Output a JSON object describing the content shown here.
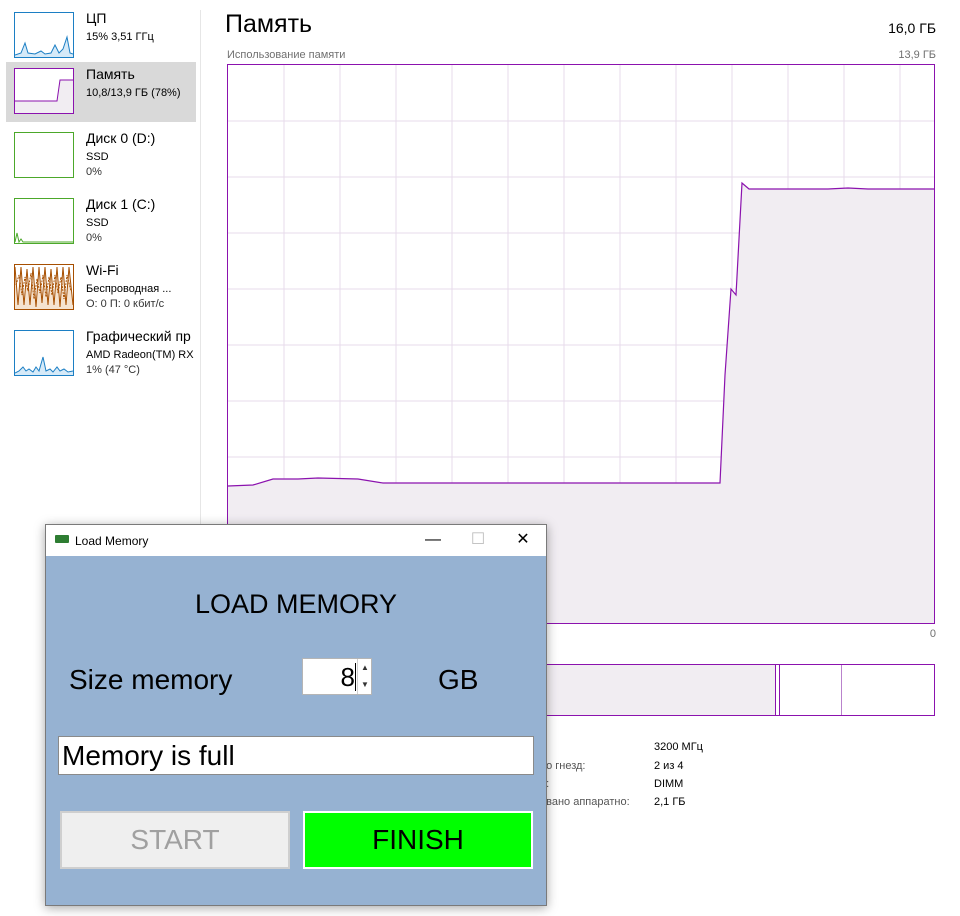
{
  "side": {
    "items": [
      {
        "title": "ЦП",
        "line1": "15%  3,51 ГГц",
        "line2": ""
      },
      {
        "title": "Память",
        "line1": "10,8/13,9 ГБ (78%)",
        "line2": ""
      },
      {
        "title": "Диск 0 (D:)",
        "line1": "SSD",
        "line2": "0%"
      },
      {
        "title": "Диск 1 (C:)",
        "line1": "SSD",
        "line2": "0%"
      },
      {
        "title": "Wi-Fi",
        "line1": "Беспроводная ...",
        "line2": "О: 0  П: 0 кбит/с"
      },
      {
        "title": "Графический пр",
        "line1": "AMD Radeon(TM) RX",
        "line2": "1%  (47 °C)"
      }
    ]
  },
  "main": {
    "title": "Память",
    "total": "16,0 ГБ",
    "usage_label": "Использование памяти",
    "usage_max": "13,9 ГБ",
    "graph_zero": "0",
    "stats": [
      {
        "label": "",
        "value": "3200 МГц"
      },
      {
        "label": "но гнезд:",
        "value": "2 из 4"
      },
      {
        "label": "р:",
        "value": "DIMM"
      },
      {
        "label": "овано аппаратно:",
        "value": "2,1 ГБ"
      }
    ],
    "accent_color": "#8b12ae"
  },
  "dialog": {
    "window_title": "Load Memory",
    "heading": "LOAD MEMORY",
    "size_label": "Size memory",
    "size_value": "8",
    "unit": "GB",
    "message": "Memory is full",
    "start_label": "START",
    "finish_label": "FINISH",
    "minimize_glyph": "—",
    "maximize_glyph": "☐",
    "close_glyph": "✕",
    "spin_up_glyph": "▲",
    "spin_down_glyph": "▼",
    "background_color": "#96b2d2",
    "finish_color": "#00ff00"
  }
}
